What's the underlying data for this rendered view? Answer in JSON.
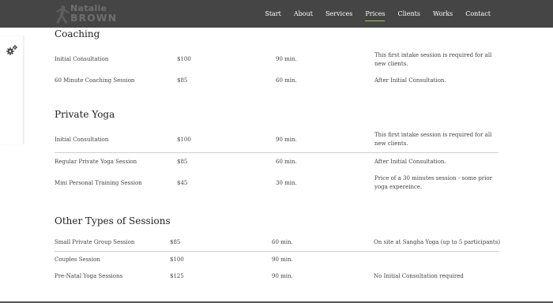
{
  "brand": {
    "line1": "Natalie",
    "line2": "BROWN"
  },
  "nav": {
    "items": [
      {
        "label": "Start",
        "active": false
      },
      {
        "label": "About",
        "active": false
      },
      {
        "label": "Services",
        "active": false
      },
      {
        "label": "Prices",
        "active": true
      },
      {
        "label": "Clients",
        "active": false
      },
      {
        "label": "Works",
        "active": false
      },
      {
        "label": "Contact",
        "active": false
      }
    ]
  },
  "side_tab": {
    "icon": "gears-icon"
  },
  "sections": {
    "coaching": {
      "title": "Coaching",
      "rows": [
        {
          "name": "Initial Consultation",
          "price": "$100",
          "duration": "90 min.",
          "note": "This first intake session is required for all new clients."
        },
        {
          "name": "60 Minute Coaching Session",
          "price": "$85",
          "duration": "60 min.",
          "note": "After Initial Consultation."
        }
      ]
    },
    "yoga": {
      "title": "Private Yoga",
      "rows": [
        {
          "name": "Initial Consultation",
          "price": "$100",
          "duration": "90 min.",
          "note": "This first intake session is required for all new clients."
        },
        {
          "name": "Regular Private Yoga Session",
          "price": "$85",
          "duration": "60 min.",
          "note": "After Initial Consultation."
        },
        {
          "name": "Mini Personal Training Session",
          "price": "$45",
          "duration": "30 min.",
          "note": "Price of a 30 minutes session - some prior yoga expereince."
        }
      ]
    },
    "other": {
      "title": "Other Types of Sessions",
      "rows": [
        {
          "name": "Small Private Group Session",
          "price": "$85",
          "duration": "60 min.",
          "note": "On site at Sangha Yoga (up to 5 participants)"
        },
        {
          "name": "Couples Session",
          "price": "$100",
          "duration": "90 min.",
          "note": ""
        },
        {
          "name": "Pre-Natal Yoga Sessions",
          "price": "$125",
          "duration": "90 min.",
          "note": "No Initial Consultation required"
        }
      ]
    }
  },
  "colors": {
    "navbar": "#454545",
    "active_underline": "#9fc63b",
    "nav_text": "#ffffff"
  }
}
